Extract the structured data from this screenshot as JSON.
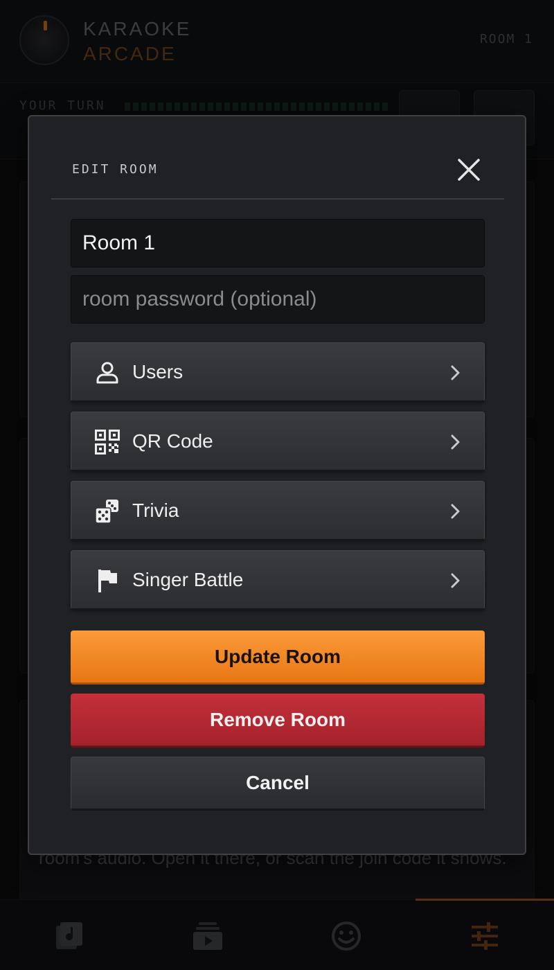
{
  "app": {
    "logo_line1": "KARAOKE",
    "logo_line2": "ARCADE",
    "room_indicator": "ROOM 1",
    "turn_label": "YOUR TURN",
    "background_text": "room's audio. Open it there, or scan the join code it shows."
  },
  "modal": {
    "title": "EDIT ROOM",
    "room_name_value": "Room 1",
    "password_placeholder": "room password (optional)",
    "menu": [
      {
        "label": "Users",
        "icon": "user-icon"
      },
      {
        "label": "QR Code",
        "icon": "qr-code-icon"
      },
      {
        "label": "Trivia",
        "icon": "dice-icon"
      },
      {
        "label": "Singer Battle",
        "icon": "flag-icon"
      }
    ],
    "buttons": {
      "update": "Update Room",
      "remove": "Remove Room",
      "cancel": "Cancel"
    }
  },
  "nav": [
    {
      "icon": "music-library-icon",
      "active": false
    },
    {
      "icon": "queue-icon",
      "active": false
    },
    {
      "icon": "smiley-icon",
      "active": false
    },
    {
      "icon": "sliders-icon",
      "active": true
    }
  ],
  "colors": {
    "accent": "#f58b24",
    "danger": "#b1282f",
    "modal_bg": "#202124"
  }
}
